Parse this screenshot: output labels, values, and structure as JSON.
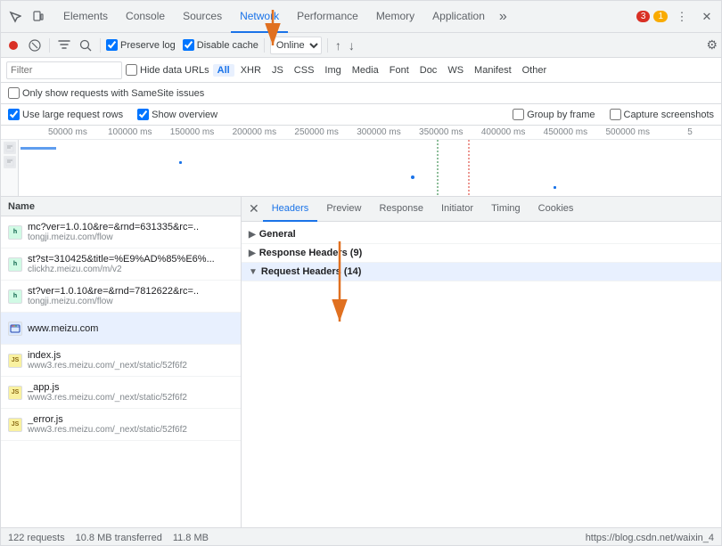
{
  "tabs": {
    "items": [
      {
        "label": "Elements"
      },
      {
        "label": "Console"
      },
      {
        "label": "Sources"
      },
      {
        "label": "Network"
      },
      {
        "label": "Performance"
      },
      {
        "label": "Memory"
      },
      {
        "label": "Application"
      }
    ],
    "active": "Network",
    "more": "»",
    "badges": {
      "red": "3",
      "yellow": "1"
    },
    "icons": {
      "settings": "⚙",
      "dots": "⋮",
      "close": "✕"
    }
  },
  "toolbar": {
    "record": "⏺",
    "clear": "🚫",
    "filter": "⊘",
    "search": "🔍",
    "preserve_log": "Preserve log",
    "disable_cache": "Disable cache",
    "throttle": "Online",
    "import": "↑",
    "export": "↓",
    "settings": "⚙"
  },
  "filter": {
    "placeholder": "Filter",
    "hide_data_urls": "Hide data URLs",
    "types": [
      {
        "label": "All",
        "active": true
      },
      {
        "label": "XHR"
      },
      {
        "label": "JS"
      },
      {
        "label": "CSS"
      },
      {
        "label": "Img"
      },
      {
        "label": "Media"
      },
      {
        "label": "Font"
      },
      {
        "label": "Doc"
      },
      {
        "label": "WS"
      },
      {
        "label": "Manifest"
      },
      {
        "label": "Other"
      }
    ]
  },
  "options": {
    "same_site": "Only show requests with SameSite issues",
    "large_rows": "Use large request rows",
    "show_overview": "Show overview",
    "group_by_frame": "Group by frame",
    "capture_screenshots": "Capture screenshots"
  },
  "timeline": {
    "marks": [
      "50000 ms",
      "100000 ms",
      "150000 ms",
      "200000 ms",
      "250000 ms",
      "300000 ms",
      "350000 ms",
      "400000 ms",
      "450000 ms",
      "500000 ms",
      "5"
    ]
  },
  "request_list": {
    "header": "Name",
    "items": [
      {
        "name": "mc?ver=1.0.10&re=&rnd=631335&rc=..",
        "url": "tongji.meizu.com/flow",
        "type": "xhr",
        "selected": false
      },
      {
        "name": "st?st=310425&title=%E9%AD%85%E6%...",
        "url": "clickhz.meizu.com/m/v2",
        "type": "xhr",
        "selected": false
      },
      {
        "name": "st?ver=1.0.10&re=&rnd=7812622&rc=..",
        "url": "tongji.meizu.com/flow",
        "type": "xhr",
        "selected": false
      },
      {
        "name": "www.meizu.com",
        "url": "",
        "type": "html",
        "selected": true
      },
      {
        "name": "index.js",
        "url": "www3.res.meizu.com/_next/static/52f6f2",
        "type": "js",
        "selected": false
      },
      {
        "name": "_app.js",
        "url": "www3.res.meizu.com/_next/static/52f6f2",
        "type": "js",
        "selected": false
      },
      {
        "name": "_error.js",
        "url": "www3.res.meizu.com/_next/static/52f6f2",
        "type": "js",
        "selected": false
      }
    ]
  },
  "detail": {
    "tabs": [
      "Headers",
      "Preview",
      "Response",
      "Initiator",
      "Timing",
      "Cookies"
    ],
    "active_tab": "Headers",
    "sections": [
      {
        "label": "General",
        "expanded": false
      },
      {
        "label": "Response Headers (9)",
        "expanded": false
      },
      {
        "label": "Request Headers (14)",
        "expanded": true
      }
    ]
  },
  "status_bar": {
    "requests": "122 requests",
    "transferred": "10.8 MB transferred",
    "size": "11.8 MB",
    "url": "https://blog.csdn.net/waixin_4"
  }
}
